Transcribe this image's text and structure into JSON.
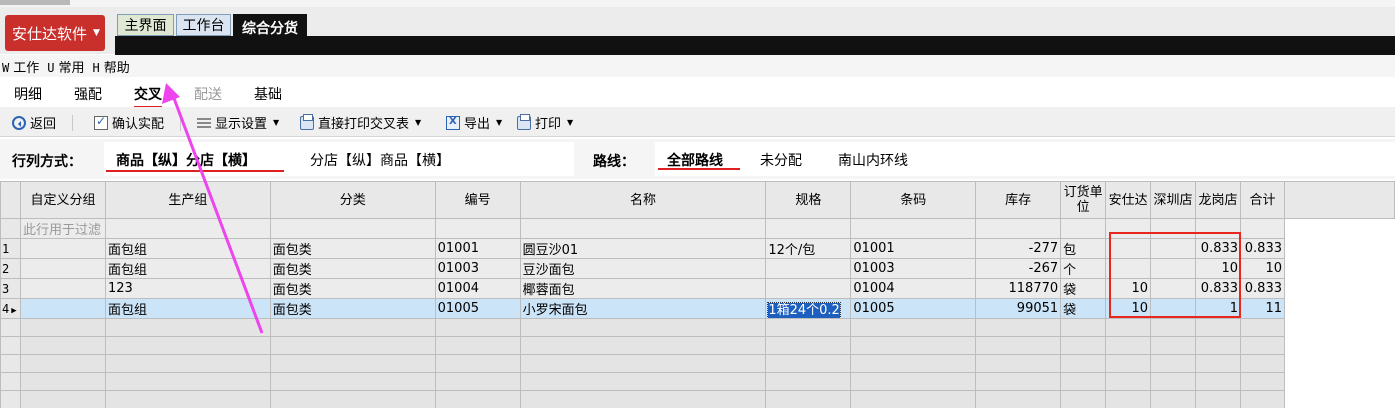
{
  "app": {
    "brand_label": "安仕达软件",
    "tabs": [
      {
        "label": "主界面"
      },
      {
        "label": "工作台"
      },
      {
        "label": "综合分货"
      }
    ]
  },
  "menu": [
    {
      "key": "W",
      "label": "工作"
    },
    {
      "key": "U",
      "label": "常用"
    },
    {
      "key": "H",
      "label": "帮助"
    }
  ],
  "modes": [
    {
      "label": "明细"
    },
    {
      "label": "强配"
    },
    {
      "label": "交叉"
    },
    {
      "label": "配送"
    },
    {
      "label": "基础"
    }
  ],
  "toolbar": {
    "back": "返回",
    "confirm": "确认实配",
    "display": "显示设置",
    "print_direct": "直接打印交叉表",
    "export": "导出",
    "print": "打印"
  },
  "filters": {
    "layout_label": "行列方式：",
    "layout_options": [
      "商品【纵】分店【横】",
      "分店【纵】商品【横】"
    ],
    "route_label": "路线：",
    "route_options": [
      "全部路线",
      "未分配",
      "南山内环线"
    ]
  },
  "grid": {
    "headers": [
      "自定义分组",
      "生产组",
      "分类",
      "编号",
      "名称",
      "规格",
      "条码",
      "库存",
      "订货单位",
      "安仕达",
      "深圳店",
      "龙岗店",
      "合计"
    ],
    "filter_row_text": "此行用于过滤",
    "rows": [
      {
        "rn": "1",
        "group": "",
        "prod": "面包组",
        "cat": "面包类",
        "code": "01001",
        "name": "圆豆沙01",
        "spec": "12个/包",
        "barcode": "01001",
        "stock": "-277",
        "unit": "包",
        "a": "",
        "b": "",
        "c": "0.833",
        "total": "0.833"
      },
      {
        "rn": "2",
        "group": "",
        "prod": "面包组",
        "cat": "面包类",
        "code": "01003",
        "name": "豆沙面包",
        "spec": "",
        "barcode": "01003",
        "stock": "-267",
        "unit": "个",
        "a": "",
        "b": "",
        "c": "10",
        "total": "10"
      },
      {
        "rn": "3",
        "group": "",
        "prod": "123",
        "cat": "面包类",
        "code": "01004",
        "name": "椰蓉面包",
        "spec": "",
        "barcode": "01004",
        "stock": "118770",
        "unit": "袋",
        "a": "10",
        "b": "",
        "c": "0.833",
        "total": "0.833"
      },
      {
        "rn": "4",
        "group": "",
        "prod": "面包组",
        "cat": "面包类",
        "code": "01005",
        "name": "小罗宋面包",
        "spec": "1箱24个0.2",
        "barcode": "01005",
        "stock": "99051",
        "unit": "袋",
        "a": "10",
        "b": "",
        "c": "1",
        "total": "11"
      }
    ]
  },
  "colors": {
    "brand": "#c9302c",
    "highlight": "#e8281e",
    "arrow": "#ee44ee",
    "selection": "#cce4f7"
  }
}
